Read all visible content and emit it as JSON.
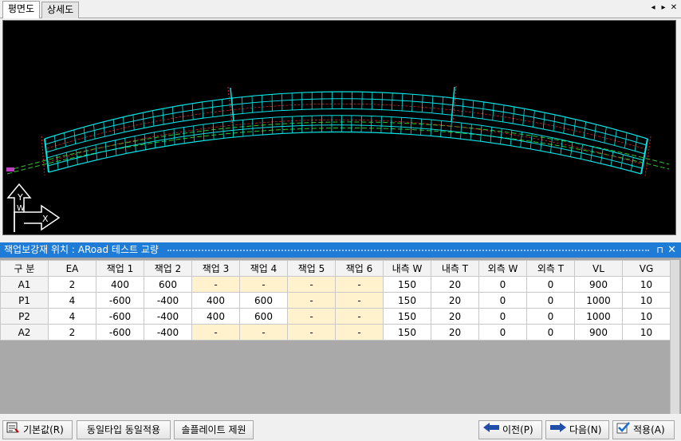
{
  "tabs": [
    {
      "label": "평면도",
      "active": true
    },
    {
      "label": "상세도",
      "active": false
    }
  ],
  "tab_controls": {
    "prev": "◂",
    "next": "▸",
    "close": "✕"
  },
  "axis": {
    "y_label": "Y",
    "x_label": "X",
    "w_label": "W"
  },
  "panel": {
    "title": "잭업보강재 위치 : ARoad 테스트 교량",
    "pin": "⊓",
    "close": "✕"
  },
  "table": {
    "columns": [
      "구 분",
      "EA",
      "잭업 1",
      "잭업 2",
      "잭업 3",
      "잭업 4",
      "잭업 5",
      "잭업 6",
      "내측 W",
      "내측 T",
      "외측 W",
      "외측 T",
      "VL",
      "VG"
    ],
    "rows": [
      [
        "A1",
        "2",
        "400",
        "600",
        "-",
        "-",
        "-",
        "-",
        "150",
        "20",
        "0",
        "0",
        "900",
        "10"
      ],
      [
        "P1",
        "4",
        "-600",
        "-400",
        "400",
        "600",
        "-",
        "-",
        "150",
        "20",
        "0",
        "0",
        "1000",
        "10"
      ],
      [
        "P2",
        "4",
        "-600",
        "-400",
        "400",
        "600",
        "-",
        "-",
        "150",
        "20",
        "0",
        "0",
        "1000",
        "10"
      ],
      [
        "A2",
        "2",
        "-600",
        "-400",
        "-",
        "-",
        "-",
        "-",
        "150",
        "20",
        "0",
        "0",
        "900",
        "10"
      ]
    ],
    "disabled_color": "#fff2cc"
  },
  "buttons": {
    "default": "기본값(R)",
    "same_type": "동일타입 동일적용",
    "remove_plate": "솔플레이트 제원",
    "prev": "이전(P)",
    "next": "다음(N)",
    "apply": "적용(A)"
  },
  "colors": {
    "title_bar": "#1e7bd6",
    "drawing_line": "#00e5e5",
    "canvas": "#000000"
  }
}
